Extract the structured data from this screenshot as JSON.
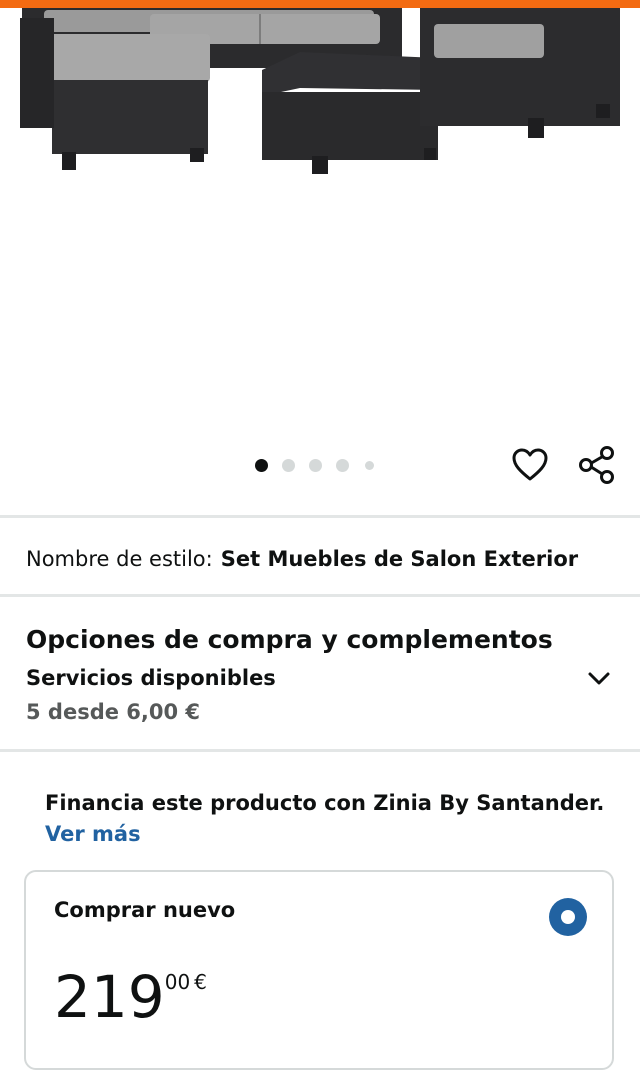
{
  "colors": {
    "accent_orange": "#f36b12",
    "link_blue": "#2162a1",
    "muted_text": "#565959",
    "divider": "#e3e6e6"
  },
  "gallery": {
    "image_count": 5,
    "active_index": 0
  },
  "actions": {
    "favorite_icon": "heart-icon",
    "share_icon": "share-icon"
  },
  "style": {
    "label": "Nombre de estilo:",
    "value": "Set Muebles de Salon Exterior"
  },
  "options": {
    "title": "Opciones de compra y complementos",
    "subtitle": "Servicios disponibles",
    "price_text": "5 desde 6,00 €"
  },
  "finance": {
    "text": "Financia este producto con Zinia By Santander.",
    "link": "Ver más"
  },
  "buy_new": {
    "label": "Comprar nuevo",
    "selected": true,
    "price_whole": "219",
    "price_fraction": "00",
    "currency": "€"
  }
}
